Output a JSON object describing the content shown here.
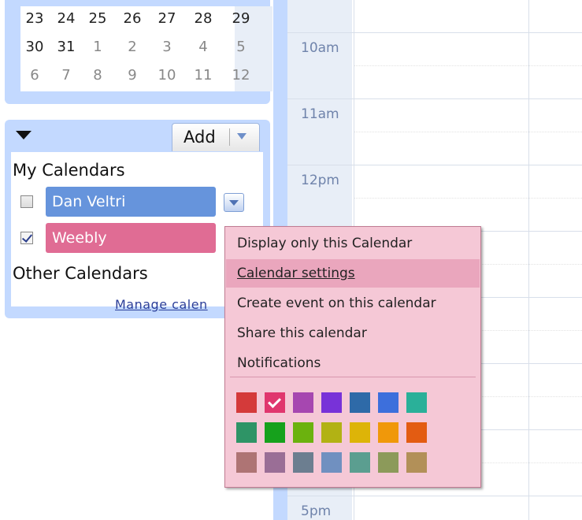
{
  "mini_calendar": {
    "rows": [
      [
        {
          "d": "23",
          "cur": true
        },
        {
          "d": "24",
          "cur": true
        },
        {
          "d": "25",
          "cur": true
        },
        {
          "d": "26",
          "cur": true
        },
        {
          "d": "27",
          "cur": true
        },
        {
          "d": "28",
          "cur": true
        },
        {
          "d": "29",
          "cur": true
        }
      ],
      [
        {
          "d": "30",
          "cur": true
        },
        {
          "d": "31",
          "cur": true
        },
        {
          "d": "1",
          "cur": false
        },
        {
          "d": "2",
          "cur": false
        },
        {
          "d": "3",
          "cur": false
        },
        {
          "d": "4",
          "cur": false
        },
        {
          "d": "5",
          "cur": false
        }
      ],
      [
        {
          "d": "6",
          "cur": false
        },
        {
          "d": "7",
          "cur": false
        },
        {
          "d": "8",
          "cur": false
        },
        {
          "d": "9",
          "cur": false
        },
        {
          "d": "10",
          "cur": false
        },
        {
          "d": "11",
          "cur": false
        },
        {
          "d": "12",
          "cur": false
        }
      ]
    ]
  },
  "calendar_list": {
    "add_label": "Add",
    "my_calendars_label": "My Calendars",
    "other_calendars_label": "Other Calendars",
    "manage_link": "Manage calen",
    "calendars": [
      {
        "name": "Dan Veltri",
        "checked": false,
        "color": "#6694dc"
      },
      {
        "name": "Weebly",
        "checked": true,
        "color": "#e06c94"
      }
    ]
  },
  "day_view": {
    "time_labels": [
      "10am",
      "11am",
      "12pm",
      "5pm"
    ]
  },
  "context_menu": {
    "items": [
      {
        "label": "Display only this Calendar",
        "hover": false
      },
      {
        "label": "Calendar settings",
        "hover": true
      },
      {
        "label": "Create event on this calendar",
        "hover": false
      },
      {
        "label": "Share this calendar",
        "hover": false
      },
      {
        "label": "Notifications",
        "hover": false
      }
    ],
    "color_swatches": [
      [
        "#d43a3a",
        "#e0366e",
        "#a647b0",
        "#7832d8",
        "#2e6aa8",
        "#3d6fdc",
        "#2ab099"
      ],
      [
        "#2e9466",
        "#16a11c",
        "#6bb20e",
        "#b2b214",
        "#ddb408",
        "#f0980a",
        "#e35c12"
      ],
      [
        "#ae7474",
        "#9a6e96",
        "#6c7e90",
        "#7090c0",
        "#5b9e90",
        "#8c9a5a",
        "#b29058"
      ]
    ],
    "selected_color": "#e0366e"
  }
}
